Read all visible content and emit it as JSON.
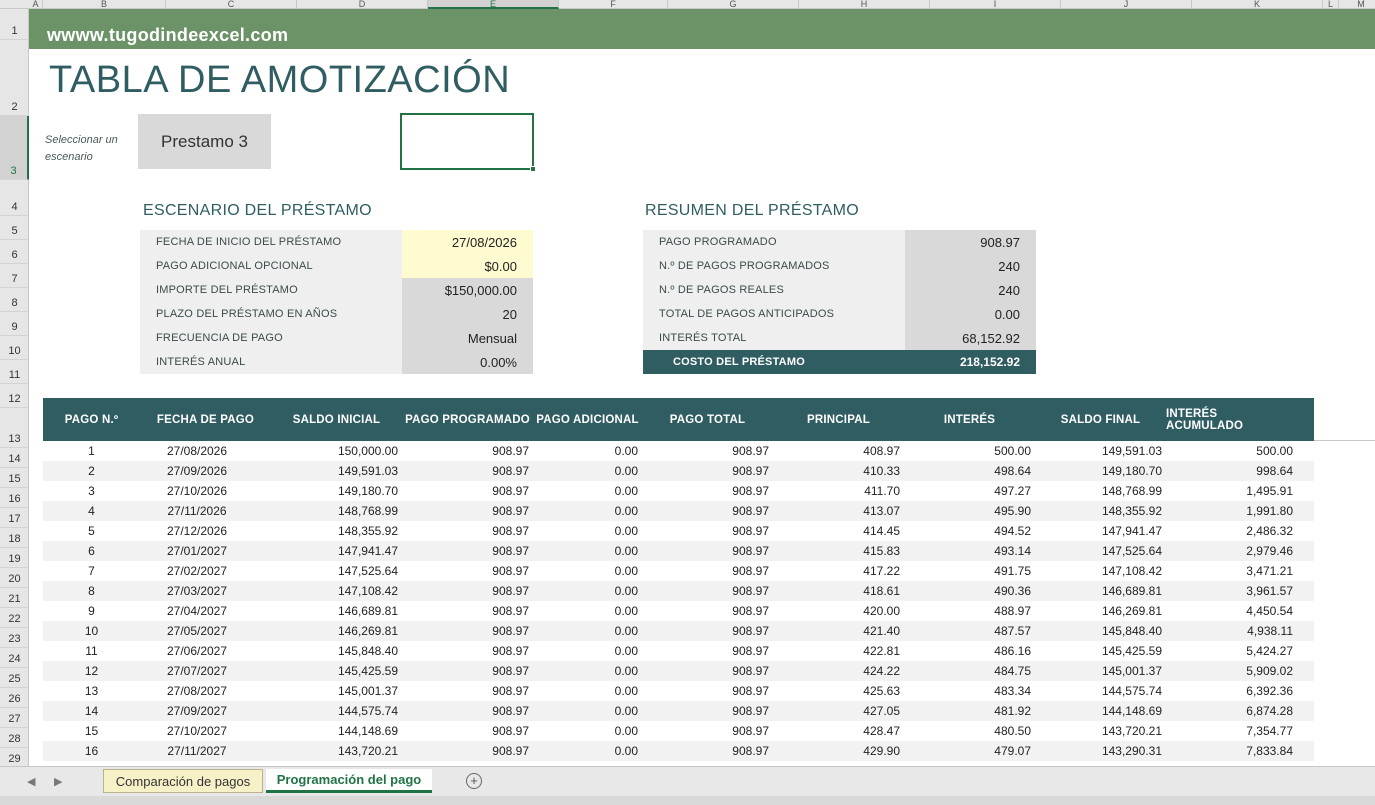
{
  "columns": [
    "A",
    "B",
    "C",
    "D",
    "E",
    "F",
    "G",
    "H",
    "I",
    "J",
    "K",
    "L",
    "M"
  ],
  "rows": [
    "1",
    "2",
    "3",
    "4",
    "5",
    "6",
    "7",
    "8",
    "9",
    "10",
    "11",
    "12",
    "13",
    "14",
    "15",
    "16",
    "17",
    "18",
    "19",
    "20",
    "21",
    "22",
    "23",
    "24",
    "25",
    "26",
    "27",
    "28",
    "29"
  ],
  "banner": {
    "url": "wwww.tugodindeexcel.com"
  },
  "title": "TABLA DE AMOTIZACIÓN",
  "selector": {
    "label": "Seleccionar un escenario",
    "value": "Prestamo 3"
  },
  "scenario": {
    "title": "ESCENARIO DEL PRÉSTAMO",
    "rows": [
      {
        "label": "FECHA DE INICIO DEL PRÉSTAMO",
        "value": "27/08/2026"
      },
      {
        "label": "PAGO ADICIONAL OPCIONAL",
        "value": "$0.00"
      },
      {
        "label": "IMPORTE DEL PRÉSTAMO",
        "value": "$150,000.00"
      },
      {
        "label": "PLAZO DEL PRÉSTAMO EN AÑOS",
        "value": "20"
      },
      {
        "label": "FRECUENCIA DE PAGO",
        "value": "Mensual"
      },
      {
        "label": "INTERÉS ANUAL",
        "value": "0.00%"
      }
    ]
  },
  "summary": {
    "title": "RESUMEN DEL PRÉSTAMO",
    "rows": [
      {
        "label": "PAGO PROGRAMADO",
        "value": "908.97"
      },
      {
        "label": "N.º DE PAGOS PROGRAMADOS",
        "value": "240"
      },
      {
        "label": "N.º DE PAGOS REALES",
        "value": "240"
      },
      {
        "label": "TOTAL DE PAGOS ANTICIPADOS",
        "value": "0.00"
      },
      {
        "label": "INTERÉS TOTAL",
        "value": "68,152.92"
      },
      {
        "label": "COSTO DEL PRÉSTAMO",
        "value": "218,152.92"
      }
    ]
  },
  "table": {
    "headers": [
      "PAGO N.º",
      "FECHA DE PAGO",
      "SALDO INICIAL",
      "PAGO PROGRAMADO",
      "PAGO ADICIONAL",
      "PAGO TOTAL",
      "PRINCIPAL",
      "INTERÉS",
      "SALDO FINAL",
      "INTERÉS ACUMULADO"
    ],
    "rows": [
      [
        "1",
        "27/08/2026",
        "150,000.00",
        "908.97",
        "0.00",
        "908.97",
        "408.97",
        "500.00",
        "149,591.03",
        "500.00"
      ],
      [
        "2",
        "27/09/2026",
        "149,591.03",
        "908.97",
        "0.00",
        "908.97",
        "410.33",
        "498.64",
        "149,180.70",
        "998.64"
      ],
      [
        "3",
        "27/10/2026",
        "149,180.70",
        "908.97",
        "0.00",
        "908.97",
        "411.70",
        "497.27",
        "148,768.99",
        "1,495.91"
      ],
      [
        "4",
        "27/11/2026",
        "148,768.99",
        "908.97",
        "0.00",
        "908.97",
        "413.07",
        "495.90",
        "148,355.92",
        "1,991.80"
      ],
      [
        "5",
        "27/12/2026",
        "148,355.92",
        "908.97",
        "0.00",
        "908.97",
        "414.45",
        "494.52",
        "147,941.47",
        "2,486.32"
      ],
      [
        "6",
        "27/01/2027",
        "147,941.47",
        "908.97",
        "0.00",
        "908.97",
        "415.83",
        "493.14",
        "147,525.64",
        "2,979.46"
      ],
      [
        "7",
        "27/02/2027",
        "147,525.64",
        "908.97",
        "0.00",
        "908.97",
        "417.22",
        "491.75",
        "147,108.42",
        "3,471.21"
      ],
      [
        "8",
        "27/03/2027",
        "147,108.42",
        "908.97",
        "0.00",
        "908.97",
        "418.61",
        "490.36",
        "146,689.81",
        "3,961.57"
      ],
      [
        "9",
        "27/04/2027",
        "146,689.81",
        "908.97",
        "0.00",
        "908.97",
        "420.00",
        "488.97",
        "146,269.81",
        "4,450.54"
      ],
      [
        "10",
        "27/05/2027",
        "146,269.81",
        "908.97",
        "0.00",
        "908.97",
        "421.40",
        "487.57",
        "145,848.40",
        "4,938.11"
      ],
      [
        "11",
        "27/06/2027",
        "145,848.40",
        "908.97",
        "0.00",
        "908.97",
        "422.81",
        "486.16",
        "145,425.59",
        "5,424.27"
      ],
      [
        "12",
        "27/07/2027",
        "145,425.59",
        "908.97",
        "0.00",
        "908.97",
        "424.22",
        "484.75",
        "145,001.37",
        "5,909.02"
      ],
      [
        "13",
        "27/08/2027",
        "145,001.37",
        "908.97",
        "0.00",
        "908.97",
        "425.63",
        "483.34",
        "144,575.74",
        "6,392.36"
      ],
      [
        "14",
        "27/09/2027",
        "144,575.74",
        "908.97",
        "0.00",
        "908.97",
        "427.05",
        "481.92",
        "144,148.69",
        "6,874.28"
      ],
      [
        "15",
        "27/10/2027",
        "144,148.69",
        "908.97",
        "0.00",
        "908.97",
        "428.47",
        "480.50",
        "143,720.21",
        "7,354.77"
      ],
      [
        "16",
        "27/11/2027",
        "143,720.21",
        "908.97",
        "0.00",
        "908.97",
        "429.90",
        "479.07",
        "143,290.31",
        "7,833.84"
      ]
    ]
  },
  "sheet_tabs": [
    "Comparación de pagos",
    "Programación del pago"
  ],
  "colors": {
    "banner": "#6c9367",
    "teal": "#2f5d62",
    "input": "#fdfbcf",
    "excel_green": "#217346"
  }
}
